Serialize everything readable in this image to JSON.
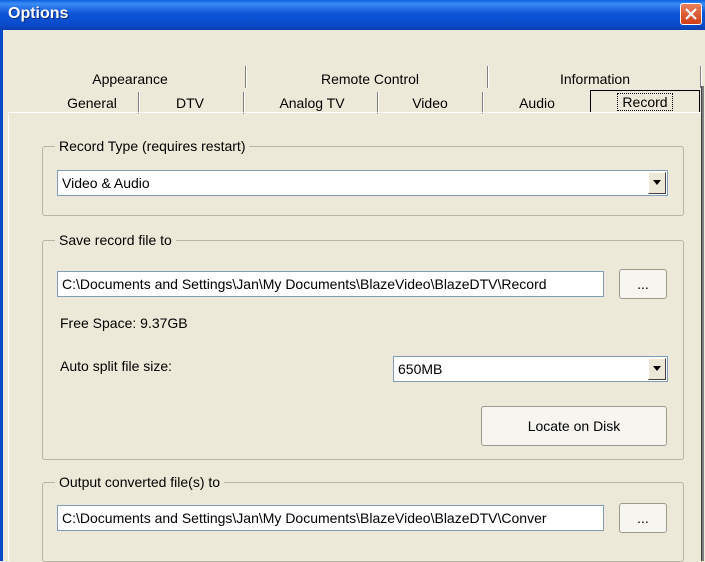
{
  "window": {
    "title": "Options"
  },
  "tabs": {
    "row_back": [
      {
        "label": "Appearance"
      },
      {
        "label": "Remote Control"
      },
      {
        "label": "Information"
      }
    ],
    "row_front": [
      {
        "label": "General"
      },
      {
        "label": "DTV"
      },
      {
        "label": "Analog TV"
      },
      {
        "label": "Video"
      },
      {
        "label": "Audio"
      },
      {
        "label": "Record"
      }
    ],
    "active": "Record"
  },
  "record_type": {
    "legend": "Record Type (requires restart)",
    "selected": "Video & Audio"
  },
  "save_record": {
    "legend": "Save record file to",
    "path": "C:\\Documents and Settings\\Jan\\My Documents\\BlazeVideo\\BlazeDTV\\Record",
    "browse_label": "...",
    "free_space": "Free Space: 9.37GB",
    "auto_split_label": "Auto split file size:",
    "auto_split_value": "650MB",
    "locate_label": "Locate on Disk"
  },
  "output_converted": {
    "legend": "Output converted file(s) to",
    "path": "C:\\Documents and Settings\\Jan\\My Documents\\BlazeVideo\\BlazeDTV\\Conver",
    "browse_label": "..."
  },
  "colors": {
    "titlebar": "#0a4ac8",
    "dialog_bg": "#ece9d8",
    "close_button": "#d9532c"
  }
}
